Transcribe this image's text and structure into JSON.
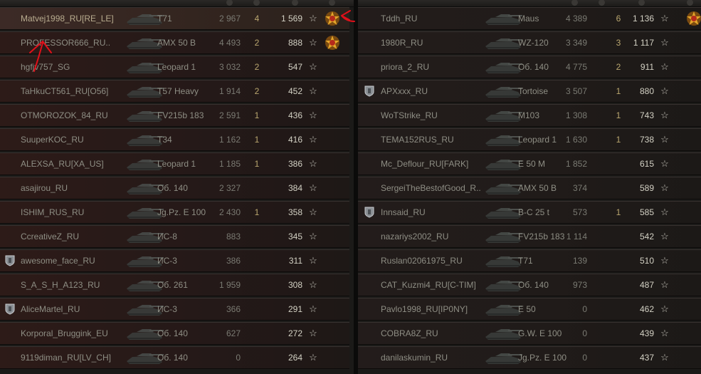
{
  "left_team": [
    {
      "name": "Matvej1998_RU[RE_LE]",
      "vehicle": "T71",
      "damage": "2 967",
      "frags": "4",
      "xp": "1 569",
      "medal": true,
      "shield": false,
      "player": true
    },
    {
      "name": "PROFESSOR666_RU..",
      "vehicle": "AMX 50 B",
      "damage": "4 493",
      "frags": "2",
      "xp": "888",
      "medal": true,
      "shield": false
    },
    {
      "name": "hgfjv757_SG",
      "vehicle": "Leopard 1",
      "damage": "3 032",
      "frags": "2",
      "xp": "547",
      "medal": false,
      "shield": false
    },
    {
      "name": "TaHkuCT561_RU[O56]",
      "vehicle": "T57 Heavy",
      "damage": "1 914",
      "frags": "2",
      "xp": "452",
      "medal": false,
      "shield": false
    },
    {
      "name": "OTMOROZOK_84_RU",
      "vehicle": "FV215b 183",
      "damage": "2 591",
      "frags": "1",
      "xp": "436",
      "medal": false,
      "shield": false
    },
    {
      "name": "SuuperKOC_RU",
      "vehicle": "T34",
      "damage": "1 162",
      "frags": "1",
      "xp": "416",
      "medal": false,
      "shield": false
    },
    {
      "name": "ALEXSA_RU[XA_US]",
      "vehicle": "Leopard 1",
      "damage": "1 185",
      "frags": "1",
      "xp": "386",
      "medal": false,
      "shield": false
    },
    {
      "name": "asajirou_RU",
      "vehicle": "Об. 140",
      "damage": "2 327",
      "frags": "",
      "xp": "384",
      "medal": false,
      "shield": false
    },
    {
      "name": "ISHIM_RUS_RU",
      "vehicle": "Jg.Pz. E 100",
      "damage": "2 430",
      "frags": "1",
      "xp": "358",
      "medal": false,
      "shield": false
    },
    {
      "name": "CcreativeZ_RU",
      "vehicle": "ИС-8",
      "damage": "883",
      "frags": "",
      "xp": "345",
      "medal": false,
      "shield": false
    },
    {
      "name": "awesome_face_RU",
      "vehicle": "ИС-3",
      "damage": "386",
      "frags": "",
      "xp": "311",
      "medal": false,
      "shield": true
    },
    {
      "name": "S_A_S_H_A123_RU",
      "vehicle": "Об. 261",
      "damage": "1 959",
      "frags": "",
      "xp": "308",
      "medal": false,
      "shield": false
    },
    {
      "name": "AliceMartel_RU",
      "vehicle": "ИС-3",
      "damage": "366",
      "frags": "",
      "xp": "291",
      "medal": false,
      "shield": true
    },
    {
      "name": "Korporal_Bruggink_EU",
      "vehicle": "Об. 140",
      "damage": "627",
      "frags": "",
      "xp": "272",
      "medal": false,
      "shield": false
    },
    {
      "name": "9119diman_RU[LV_CH]",
      "vehicle": "Об. 140",
      "damage": "0",
      "frags": "",
      "xp": "264",
      "medal": false,
      "shield": false
    }
  ],
  "right_team": [
    {
      "name": "Tddh_RU",
      "vehicle": "Maus",
      "damage": "4 389",
      "frags": "6",
      "xp": "1 136",
      "medal": true,
      "shield": false
    },
    {
      "name": "1980R_RU",
      "vehicle": "WZ-120",
      "damage": "3 349",
      "frags": "3",
      "xp": "1 117",
      "medal": false,
      "shield": false
    },
    {
      "name": "priora_2_RU",
      "vehicle": "Об. 140",
      "damage": "4 775",
      "frags": "2",
      "xp": "911",
      "medal": false,
      "shield": false
    },
    {
      "name": "APXxxx_RU",
      "vehicle": "Tortoise",
      "damage": "3 507",
      "frags": "1",
      "xp": "880",
      "medal": false,
      "shield": true
    },
    {
      "name": "WoTStrike_RU",
      "vehicle": "M103",
      "damage": "1 308",
      "frags": "1",
      "xp": "743",
      "medal": false,
      "shield": false
    },
    {
      "name": "TEMA152RUS_RU",
      "vehicle": "Leopard 1",
      "damage": "1 630",
      "frags": "1",
      "xp": "738",
      "medal": false,
      "shield": false
    },
    {
      "name": "Mc_Deflour_RU[FARK]",
      "vehicle": "E 50 M",
      "damage": "1 852",
      "frags": "",
      "xp": "615",
      "medal": false,
      "shield": false
    },
    {
      "name": "SergeiTheBestofGood_R..",
      "vehicle": "AMX 50 B",
      "damage": "374",
      "frags": "",
      "xp": "589",
      "medal": false,
      "shield": false
    },
    {
      "name": "Innsaid_RU",
      "vehicle": "B-C 25 t",
      "damage": "573",
      "frags": "1",
      "xp": "585",
      "medal": false,
      "shield": true
    },
    {
      "name": "nazariys2002_RU",
      "vehicle": "FV215b 183",
      "damage": "1 114",
      "frags": "",
      "xp": "542",
      "medal": false,
      "shield": false
    },
    {
      "name": "Ruslan02061975_RU",
      "vehicle": "T71",
      "damage": "139",
      "frags": "",
      "xp": "510",
      "medal": false,
      "shield": false
    },
    {
      "name": "CAT_Kuzmi4_RU[C-TIM]",
      "vehicle": "Об. 140",
      "damage": "973",
      "frags": "",
      "xp": "487",
      "medal": false,
      "shield": false
    },
    {
      "name": "Pavlo1998_RU[IP0NY]",
      "vehicle": "E 50",
      "damage": "0",
      "frags": "",
      "xp": "462",
      "medal": false,
      "shield": false
    },
    {
      "name": "COBRA8Z_RU",
      "vehicle": "G.W. E 100",
      "damage": "0",
      "frags": "",
      "xp": "439",
      "medal": false,
      "shield": false
    },
    {
      "name": "danilaskumin_RU",
      "vehicle": "Jg.Pz. E 100",
      "damage": "0",
      "frags": "",
      "xp": "437",
      "medal": false,
      "shield": false
    }
  ],
  "icons": {
    "star_glyph": "☆",
    "medal_icon": "medal-icon",
    "shield_icon": "platoon-shield-icon",
    "tank_icon": "tank-icon"
  },
  "colors": {
    "annotation": "#e0101a",
    "frags": "#b9a66f",
    "xp": "#d3d1c4",
    "text": "#8e8e84"
  }
}
